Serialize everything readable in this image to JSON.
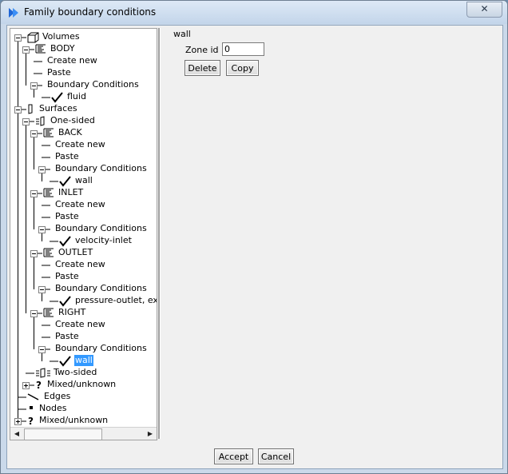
{
  "window": {
    "title": "Family boundary conditions",
    "close_glyph": "✕"
  },
  "tree": [
    {
      "label": "Volumes",
      "depth": 0,
      "expander": "minus",
      "icon": "volume-cube-icon"
    },
    {
      "label": "BODY",
      "depth": 1,
      "expander": "minus",
      "icon": "list-lines-icon"
    },
    {
      "label": "Create new",
      "depth": 2,
      "expander": "none",
      "icon": "none"
    },
    {
      "label": "Paste",
      "depth": 2,
      "expander": "none",
      "icon": "none"
    },
    {
      "label": "Boundary Conditions",
      "depth": 2,
      "expander": "minus",
      "icon": "none"
    },
    {
      "label": "fluid",
      "depth": 3,
      "expander": "none",
      "icon": "checkmark-icon"
    },
    {
      "label": "Surfaces",
      "depth": 0,
      "expander": "minus",
      "icon": "surface-sheet-icon"
    },
    {
      "label": "One-sided",
      "depth": 1,
      "expander": "minus",
      "icon": "one-sided-icon"
    },
    {
      "label": "BACK",
      "depth": 2,
      "expander": "minus",
      "icon": "list-lines-icon"
    },
    {
      "label": "Create new",
      "depth": 3,
      "expander": "none",
      "icon": "none"
    },
    {
      "label": "Paste",
      "depth": 3,
      "expander": "none",
      "icon": "none"
    },
    {
      "label": "Boundary Conditions",
      "depth": 3,
      "expander": "minus",
      "icon": "none"
    },
    {
      "label": "wall",
      "depth": 4,
      "expander": "none",
      "icon": "checkmark-icon"
    },
    {
      "label": "INLET",
      "depth": 2,
      "expander": "minus",
      "icon": "list-lines-icon"
    },
    {
      "label": "Create new",
      "depth": 3,
      "expander": "none",
      "icon": "none"
    },
    {
      "label": "Paste",
      "depth": 3,
      "expander": "none",
      "icon": "none"
    },
    {
      "label": "Boundary Conditions",
      "depth": 3,
      "expander": "minus",
      "icon": "none"
    },
    {
      "label": "velocity-inlet",
      "depth": 4,
      "expander": "none",
      "icon": "checkmark-icon"
    },
    {
      "label": "OUTLET",
      "depth": 2,
      "expander": "minus",
      "icon": "list-lines-icon"
    },
    {
      "label": "Create new",
      "depth": 3,
      "expander": "none",
      "icon": "none"
    },
    {
      "label": "Paste",
      "depth": 3,
      "expander": "none",
      "icon": "none"
    },
    {
      "label": "Boundary Conditions",
      "depth": 3,
      "expander": "minus",
      "icon": "none"
    },
    {
      "label": "pressure-outlet, exha",
      "depth": 4,
      "expander": "none",
      "icon": "checkmark-icon"
    },
    {
      "label": "RIGHT",
      "depth": 2,
      "expander": "minus",
      "icon": "list-lines-icon"
    },
    {
      "label": "Create new",
      "depth": 3,
      "expander": "none",
      "icon": "none"
    },
    {
      "label": "Paste",
      "depth": 3,
      "expander": "none",
      "icon": "none"
    },
    {
      "label": "Boundary Conditions",
      "depth": 3,
      "expander": "minus",
      "icon": "none"
    },
    {
      "label": "wall",
      "depth": 4,
      "expander": "none",
      "icon": "checkmark-icon",
      "selected": true
    },
    {
      "label": "Two-sided",
      "depth": 1,
      "expander": "none",
      "icon": "two-sided-icon"
    },
    {
      "label": "Mixed/unknown",
      "depth": 1,
      "expander": "plus",
      "icon": "question-icon"
    },
    {
      "label": "Edges",
      "depth": 0,
      "expander": "none",
      "icon": "edge-icon"
    },
    {
      "label": "Nodes",
      "depth": 0,
      "expander": "none",
      "icon": "node-icon"
    },
    {
      "label": "Mixed/unknown",
      "depth": 0,
      "expander": "plus",
      "icon": "question-icon"
    }
  ],
  "scrollbar": {
    "left_glyph": "◀",
    "right_glyph": "▶"
  },
  "detail": {
    "heading": "wall",
    "zone_label": "Zone id",
    "zone_value": "0",
    "delete_label": "Delete",
    "copy_label": "Copy"
  },
  "footer": {
    "accept_label": "Accept",
    "cancel_label": "Cancel"
  }
}
